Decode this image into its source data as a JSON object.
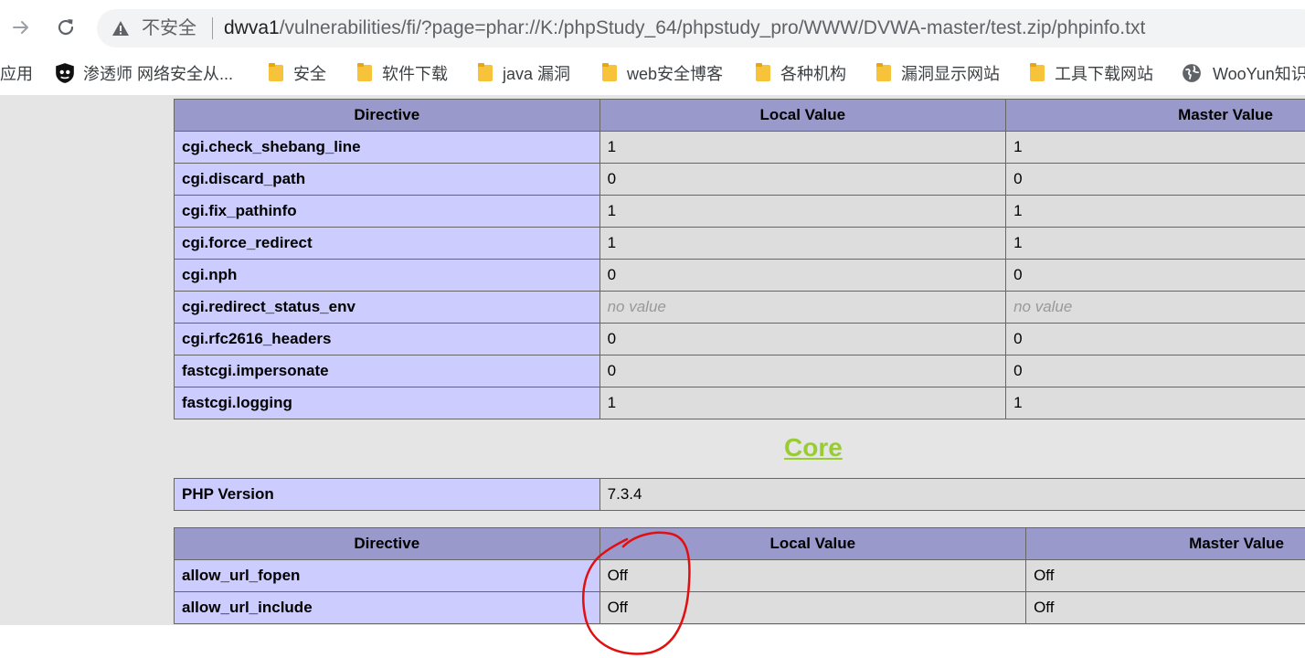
{
  "browser": {
    "security_label": "不安全",
    "url_host": "dwva1",
    "url_rest": "/vulnerabilities/fi/?page=phar://K:/phpStudy_64/phpstudy_pro/WWW/DVWA-master/test.zip/phpinfo.txt",
    "icons": {
      "back": "arrow-right-icon",
      "reload": "reload-icon",
      "warning": "warning-triangle-icon"
    }
  },
  "bookmarks": [
    {
      "label": "应用",
      "icon": "apps-icon"
    },
    {
      "label": "渗透师 网络安全从...",
      "icon": "shield-logo-icon"
    },
    {
      "label": "安全",
      "icon": "folder-icon"
    },
    {
      "label": "软件下载",
      "icon": "folder-icon"
    },
    {
      "label": "java 漏洞",
      "icon": "folder-icon"
    },
    {
      "label": "web安全博客",
      "icon": "folder-icon"
    },
    {
      "label": "各种机构",
      "icon": "folder-icon"
    },
    {
      "label": "漏洞显示网站",
      "icon": "folder-icon"
    },
    {
      "label": "工具下载网站",
      "icon": "folder-icon"
    },
    {
      "label": "WooYun知识",
      "icon": "globe-icon"
    }
  ],
  "cgi_table": {
    "headers": [
      "Directive",
      "Local Value",
      "Master Value"
    ],
    "rows": [
      {
        "directive": "cgi.check_shebang_line",
        "local": "1",
        "master": "1"
      },
      {
        "directive": "cgi.discard_path",
        "local": "0",
        "master": "0"
      },
      {
        "directive": "cgi.fix_pathinfo",
        "local": "1",
        "master": "1"
      },
      {
        "directive": "cgi.force_redirect",
        "local": "1",
        "master": "1"
      },
      {
        "directive": "cgi.nph",
        "local": "0",
        "master": "0"
      },
      {
        "directive": "cgi.redirect_status_env",
        "local": "no value",
        "master": "no value"
      },
      {
        "directive": "cgi.rfc2616_headers",
        "local": "0",
        "master": "0"
      },
      {
        "directive": "fastcgi.impersonate",
        "local": "0",
        "master": "0"
      },
      {
        "directive": "fastcgi.logging",
        "local": "1",
        "master": "1"
      }
    ]
  },
  "core": {
    "title": "Core",
    "version_label": "PHP Version",
    "version_value": "7.3.4"
  },
  "core_table": {
    "headers": [
      "Directive",
      "Local Value",
      "Master Value"
    ],
    "rows": [
      {
        "directive": "allow_url_fopen",
        "local": "Off",
        "master": "Off"
      },
      {
        "directive": "allow_url_include",
        "local": "Off",
        "master": "Off"
      }
    ]
  },
  "colors": {
    "header_bg": "#9999cc",
    "directive_bg": "#ccccff",
    "value_bg": "#dddddd",
    "core_title": "#99cc33",
    "annotation": "#e01010"
  }
}
